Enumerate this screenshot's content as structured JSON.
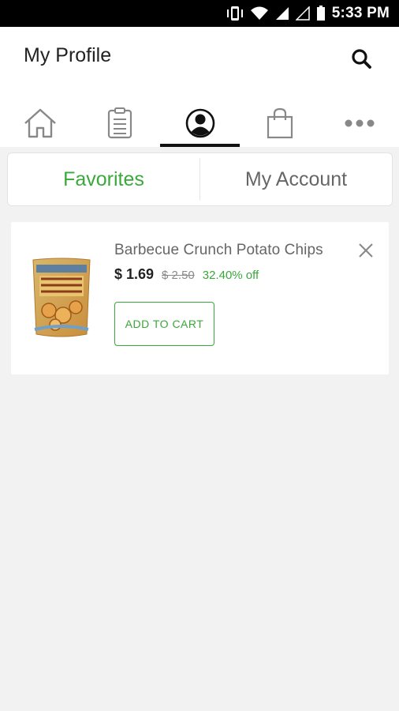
{
  "status_bar": {
    "time": "5:33 PM",
    "icons": [
      "vibrate-icon",
      "wifi-icon",
      "signal-icon",
      "signal-empty-icon",
      "battery-icon"
    ]
  },
  "header": {
    "title": "My Profile",
    "search_icon": "search-icon"
  },
  "nav": {
    "tabs": [
      {
        "icon": "home-icon",
        "active": false
      },
      {
        "icon": "list-icon",
        "active": false
      },
      {
        "icon": "profile-icon",
        "active": true
      },
      {
        "icon": "shopping-bag-icon",
        "active": false
      },
      {
        "icon": "more-icon",
        "active": false
      }
    ]
  },
  "segments": {
    "favorites": "Favorites",
    "my_account": "My Account",
    "active": "favorites"
  },
  "favorites": {
    "items": [
      {
        "name": "Barbecue Crunch Potato Chips",
        "price": "$ 1.69",
        "old_price": "$ 2.50",
        "discount": "32.40% off",
        "add_to_cart": "ADD TO CART",
        "package_text_top": "TRADER JOE'S",
        "package_text": "BARBECUE CRUNCH"
      }
    ]
  },
  "colors": {
    "accent_green": "#3aa83a",
    "status_bar": "#000000",
    "background": "#f2f2f2"
  }
}
